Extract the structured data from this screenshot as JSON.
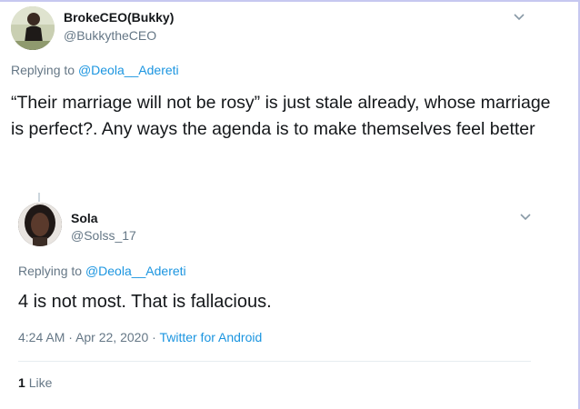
{
  "tweet1": {
    "name": "BrokeCEO(Bukky)",
    "handle": "@BukkytheCEO",
    "replying_prefix": "Replying to",
    "replying_to": "@Deola__Adereti",
    "text": "“Their marriage will not be rosy” is just stale already, whose marriage is perfect?. Any ways the agenda is to make themselves feel better",
    "menu_icon": "chevron-down-icon"
  },
  "tweet2": {
    "name": "Sola",
    "handle": "@Solss_17",
    "replying_prefix": "Replying to",
    "replying_to": "@Deola__Adereti",
    "text": "4 is not most. That is fallacious.",
    "time": "4:24 AM",
    "separator": "·",
    "date": "Apr 22, 2020",
    "source": "Twitter for Android",
    "like_count": "1",
    "like_label": "Like",
    "menu_icon": "chevron-down-icon"
  }
}
